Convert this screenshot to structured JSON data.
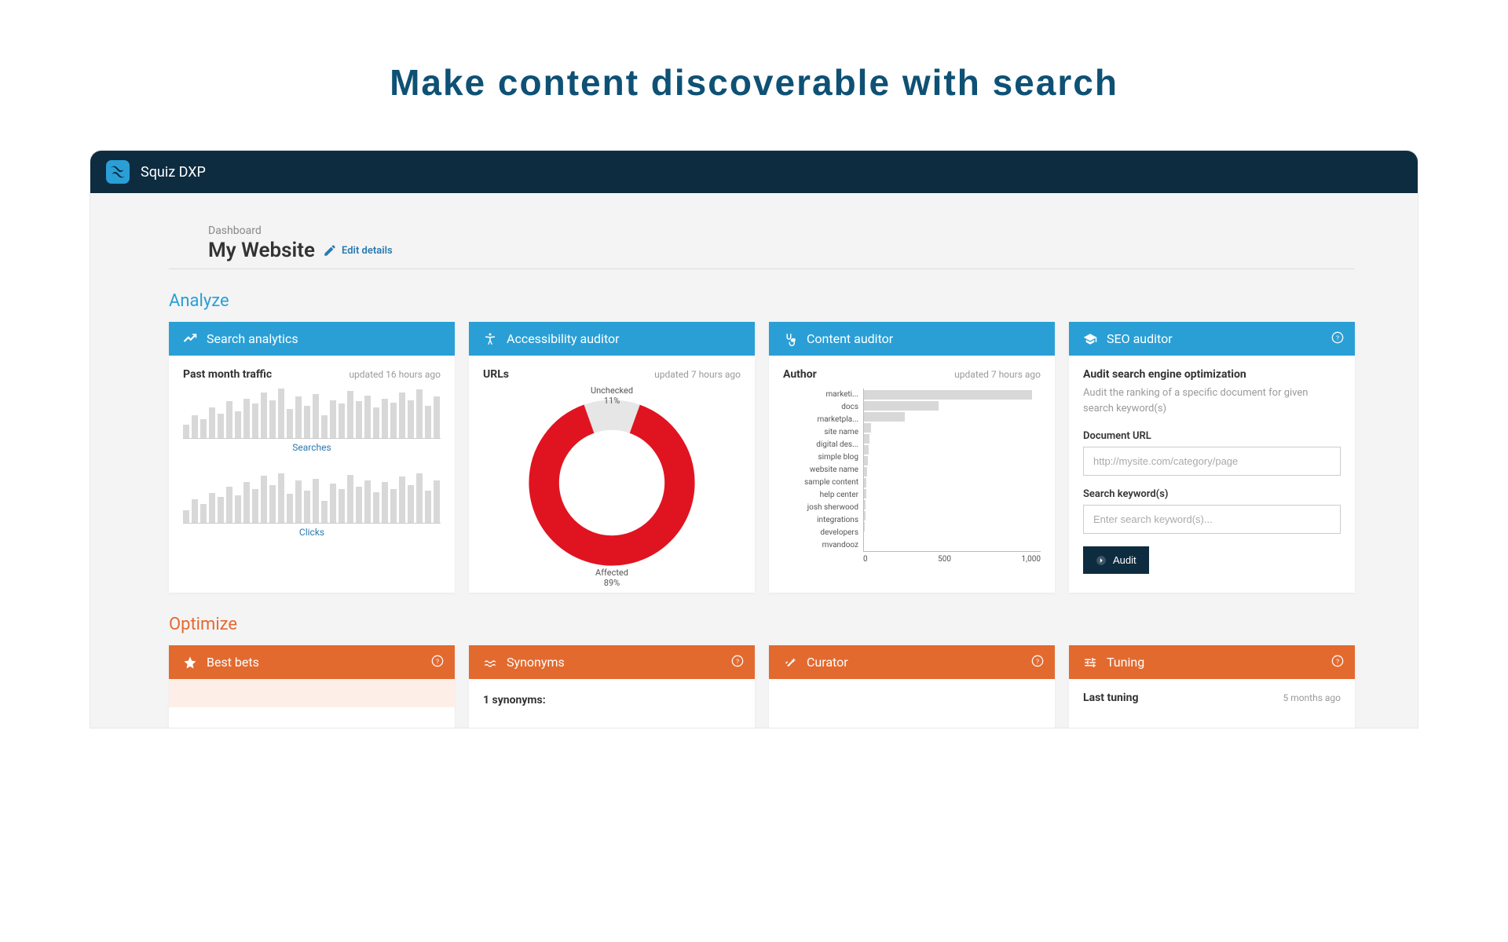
{
  "page_title": "Make content discoverable with search",
  "titlebar": {
    "app_name": "Squiz DXP"
  },
  "breadcrumb": "Dashboard",
  "site_title": "My Website",
  "edit_details": "Edit details",
  "analyze_header": "Analyze",
  "optimize_header": "Optimize",
  "cards": {
    "search_analytics": {
      "title": "Search analytics",
      "subtitle": "Past month traffic",
      "updated": "updated 16 hours ago",
      "searches_label": "Searches",
      "clicks_label": "Clicks"
    },
    "accessibility": {
      "title": "Accessibility auditor",
      "subtitle": "URLs",
      "updated": "updated 7 hours ago"
    },
    "content": {
      "title": "Content auditor",
      "subtitle": "Author",
      "updated": "updated 7 hours ago"
    },
    "seo": {
      "title": "SEO auditor",
      "subtitle": "Audit search engine optimization",
      "desc": "Audit the ranking of a specific document for given search keyword(s)",
      "url_label": "Document URL",
      "url_placeholder": "http://mysite.com/category/page",
      "kw_label": "Search keyword(s)",
      "kw_placeholder": "Enter search keyword(s)...",
      "audit_btn": "Audit"
    },
    "best_bets": {
      "title": "Best bets"
    },
    "synonyms": {
      "title": "Synonyms",
      "body": "1 synonyms:"
    },
    "curator": {
      "title": "Curator"
    },
    "tuning": {
      "title": "Tuning",
      "subtitle": "Last tuning",
      "updated": "5 months ago"
    }
  },
  "chart_data": [
    {
      "type": "bar",
      "id": "searches_sparkline",
      "title": "Searches",
      "values": [
        18,
        30,
        25,
        40,
        32,
        48,
        35,
        52,
        45,
        60,
        50,
        65,
        38,
        55,
        42,
        58,
        30,
        50,
        45,
        62,
        48,
        56,
        40,
        52,
        46,
        60,
        50,
        64,
        42,
        55
      ]
    },
    {
      "type": "bar",
      "id": "clicks_sparkline",
      "title": "Clicks",
      "values": [
        15,
        28,
        22,
        35,
        30,
        42,
        32,
        48,
        40,
        55,
        44,
        58,
        34,
        50,
        38,
        52,
        26,
        46,
        40,
        56,
        42,
        50,
        36,
        48,
        40,
        54,
        44,
        58,
        38,
        50
      ]
    },
    {
      "type": "pie",
      "id": "accessibility_donut",
      "title": "URLs",
      "series": [
        {
          "name": "Unchecked",
          "value": 11,
          "color": "#e6e6e6"
        },
        {
          "name": "Affected",
          "value": 89,
          "color": "#e01420"
        }
      ],
      "labels": {
        "top": "Unchecked\n11%",
        "bottom": "Affected\n89%"
      }
    },
    {
      "type": "bar",
      "orientation": "horizontal",
      "id": "author_hbar",
      "title": "Author",
      "xlim": [
        0,
        1000
      ],
      "xticks": [
        0,
        500,
        1000
      ],
      "categories": [
        "marketi...",
        "docs",
        "marketpla...",
        "site name",
        "digital des...",
        "simple blog",
        "website name",
        "sample content",
        "help center",
        "josh sherwood",
        "integrations",
        "developers",
        "mvandooz"
      ],
      "values": [
        950,
        420,
        230,
        40,
        30,
        25,
        22,
        18,
        15,
        12,
        10,
        8,
        6
      ]
    }
  ]
}
